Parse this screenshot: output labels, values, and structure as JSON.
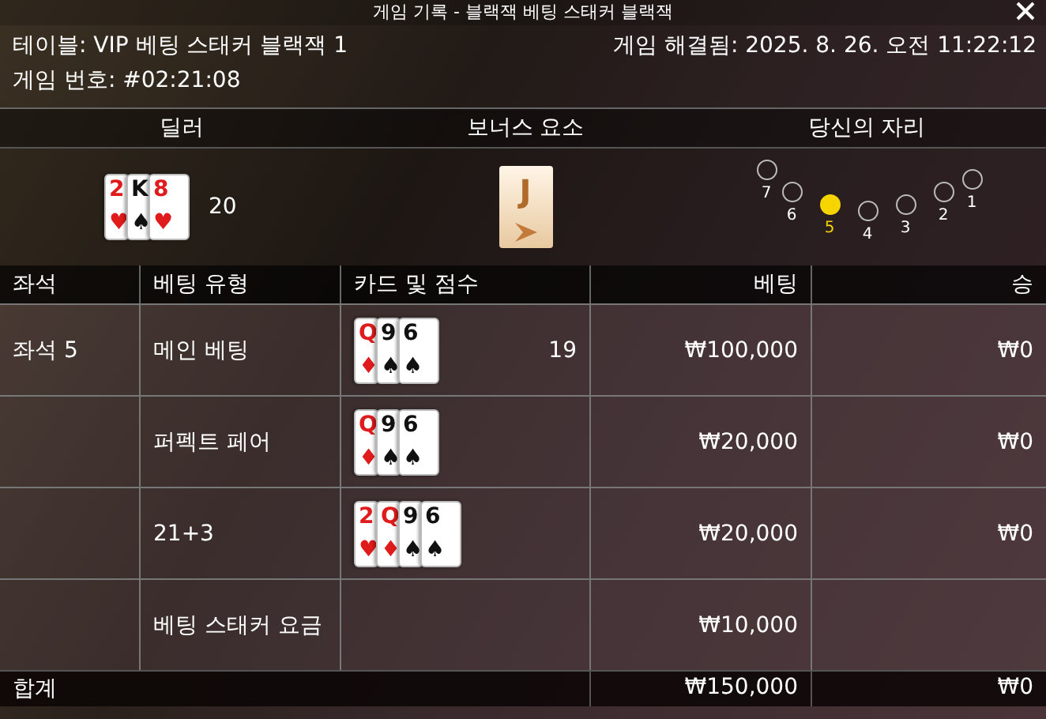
{
  "window": {
    "title": "게임 기록 - 블랙잭 베팅 스태커 블랙잭"
  },
  "info": {
    "table": "테이블: VIP 베팅 스태커 블랙잭 1",
    "resolved": "게임 해결됨: 2025. 8. 26. 오전 11:22:12",
    "game_number": "게임 번호: #02:21:08"
  },
  "summary": {
    "headers": [
      "딜러",
      "보너스 요소",
      "당신의 자리"
    ],
    "dealer": {
      "cards": [
        {
          "rank": "2",
          "suit": "♥"
        },
        {
          "rank": "K",
          "suit": "♠"
        },
        {
          "rank": "8",
          "suit": "♥"
        }
      ],
      "score": "20"
    },
    "bonus_card": {
      "rank": "J"
    },
    "seats": [
      {
        "label": "7",
        "selected": false
      },
      {
        "label": "6",
        "selected": false
      },
      {
        "label": "5",
        "selected": true
      },
      {
        "label": "4",
        "selected": false
      },
      {
        "label": "3",
        "selected": false
      },
      {
        "label": "2",
        "selected": false
      },
      {
        "label": "1",
        "selected": false
      }
    ]
  },
  "table": {
    "columns": [
      "좌석",
      "베팅 유형",
      "카드 및 점수",
      "베팅",
      "승"
    ],
    "rows": [
      {
        "seat": "좌석 5",
        "bet_type": "메인 베팅",
        "cards": [
          {
            "rank": "Q",
            "suit": "♦"
          },
          {
            "rank": "9",
            "suit": "♠"
          },
          {
            "rank": "6",
            "suit": "♠"
          }
        ],
        "score": "19",
        "bet": "₩100,000",
        "win": "₩0"
      },
      {
        "seat": "",
        "bet_type": "퍼펙트 페어",
        "cards": [
          {
            "rank": "Q",
            "suit": "♦"
          },
          {
            "rank": "9",
            "suit": "♠"
          },
          {
            "rank": "6",
            "suit": "♠"
          }
        ],
        "score": "",
        "bet": "₩20,000",
        "win": "₩0"
      },
      {
        "seat": "",
        "bet_type": "21+3",
        "cards": [
          {
            "rank": "2",
            "suit": "♥"
          },
          {
            "rank": "Q",
            "suit": "♦"
          },
          {
            "rank": "9",
            "suit": "♠"
          },
          {
            "rank": "6",
            "suit": "♠"
          }
        ],
        "score": "",
        "bet": "₩20,000",
        "win": "₩0"
      },
      {
        "seat": "",
        "bet_type": "베팅 스태커 요금",
        "cards": [],
        "score": "",
        "bet": "₩10,000",
        "win": ""
      }
    ],
    "total": {
      "label": "합계",
      "bet": "₩150,000",
      "win": "₩0"
    }
  }
}
